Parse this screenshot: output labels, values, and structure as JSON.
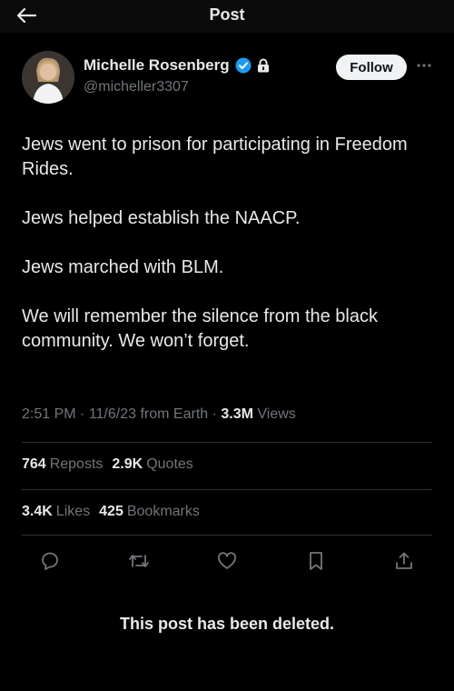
{
  "header": {
    "title": "Post"
  },
  "author": {
    "name": "Michelle Rosenberg",
    "handle": "@micheller3307",
    "verified": true,
    "protected": true
  },
  "follow_label": "Follow",
  "post": {
    "paragraphs": [
      "Jews went to prison for participating in Freedom Rides.",
      "Jews helped establish the NAACP.",
      "Jews marched with BLM.",
      "We will remember the silence from the black community. We won’t forget."
    ],
    "time": "2:51 PM",
    "date": "11/6/23",
    "source": "from Earth",
    "views_count": "3.3M",
    "views_label": "Views"
  },
  "stats": {
    "reposts": {
      "count": "764",
      "label": "Reposts"
    },
    "quotes": {
      "count": "2.9K",
      "label": "Quotes"
    },
    "likes": {
      "count": "3.4K",
      "label": "Likes"
    },
    "bookmarks": {
      "count": "425",
      "label": "Bookmarks"
    }
  },
  "icons": [
    "back-arrow-icon",
    "verified-badge-icon",
    "lock-icon",
    "more-icon",
    "reply-icon",
    "repost-icon",
    "like-icon",
    "bookmark-icon",
    "share-icon"
  ],
  "colors": {
    "background": "#000000",
    "text": "#e7e9ea",
    "muted": "#71767b",
    "verified": "#1d9bf0",
    "follow_bg": "#eff3f4"
  },
  "footer": {
    "deleted_message": "This post has been deleted."
  }
}
